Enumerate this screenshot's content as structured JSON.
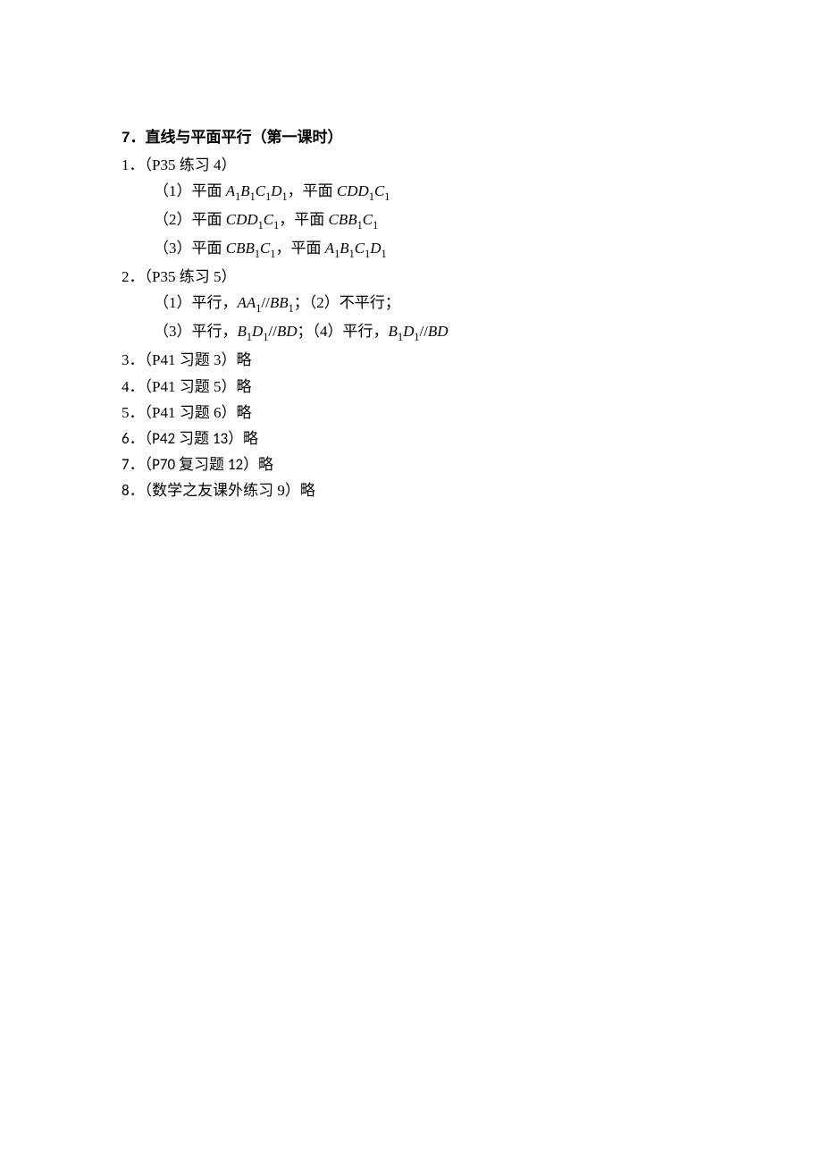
{
  "title_num": "7．",
  "title_text": "直线与平面平行（第一课时）",
  "q1": {
    "header_num": "1．",
    "header_label": "（P35 练习 4）",
    "sub1_prefix": "（1）平面 ",
    "sub1_comma": "，平面 ",
    "sub2_prefix": "（2）平面 ",
    "sub2_comma": "，平面 ",
    "sub3_prefix": "（3）平面 ",
    "sub3_comma": "，平面 "
  },
  "q2": {
    "header_num": "2．",
    "header_label": "（P35 练习 5）",
    "line1_a": "（1）平行，",
    "line1_b": "；（2）不平行；",
    "line2_a": "（3）平行，",
    "line2_b": "；（4）平行，"
  },
  "q3": {
    "num": "3．",
    "label": "（P41 习题 3）略"
  },
  "q4": {
    "num": "4．",
    "label": "（P41 习题 5）略"
  },
  "q5": {
    "num": "5．",
    "label": "（P41 习题 6）略"
  },
  "q6": {
    "num": "6．",
    "label_a": "（",
    "label_b": "P42 ",
    "label_c": "习题",
    "label_d": " 13",
    "label_e": "）略"
  },
  "q7": {
    "num": "7．",
    "label_a": "（",
    "label_b": "P70 ",
    "label_c": "复习题",
    "label_d": " 12",
    "label_e": "）略"
  },
  "q8": {
    "num": "8．",
    "label": "（数学之友课外练习 9）略"
  }
}
